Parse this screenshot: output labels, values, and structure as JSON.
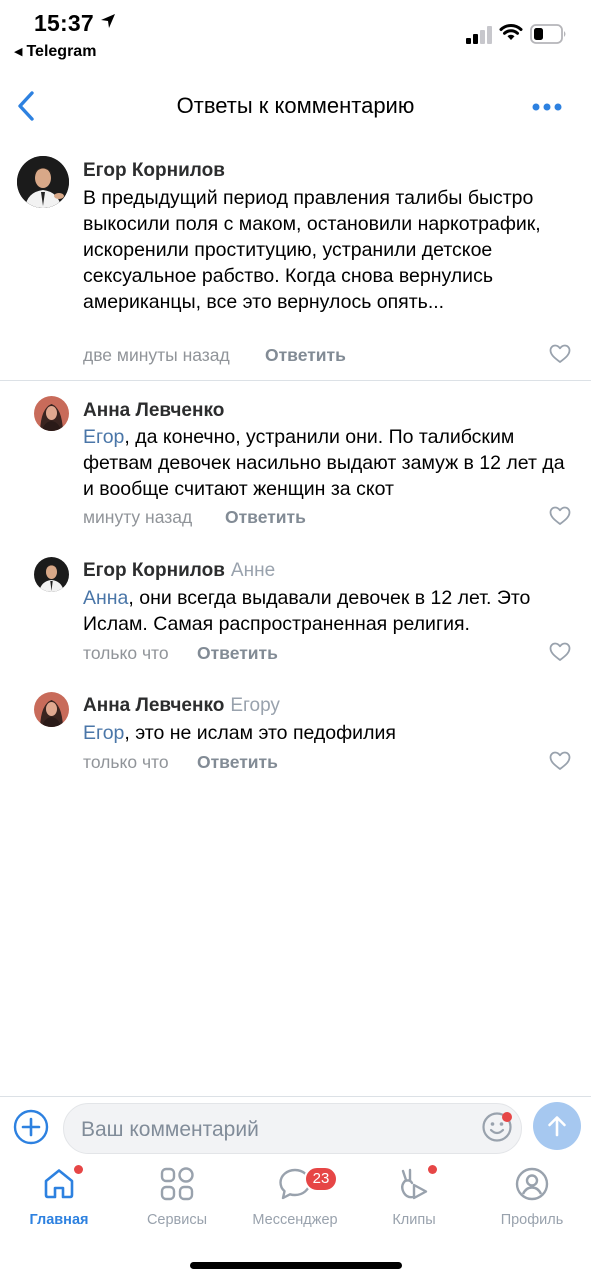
{
  "status_bar": {
    "time": "15:37",
    "back_app": "Telegram"
  },
  "header": {
    "title": "Ответы к комментарию"
  },
  "comments": [
    {
      "author": "Егор Корнилов",
      "reply_to": "",
      "mention": "",
      "text": "В предыдущий период правления талибы быстро выкосили поля с маком, остановили наркотрафик, искоренили проституцию, устранили детское сексуальное рабство.  Когда снова вернулись американцы, все это вернулось опять...",
      "time": "две минуты назад",
      "reply_label": "Ответить"
    },
    {
      "author": "Анна Левченко",
      "reply_to": "",
      "mention": "Егор",
      "text": ", да конечно, устранили они. По талибским фетвам девочек насильно выдают замуж в 12 лет да и вообще считают женщин за скот",
      "time": "минуту назад",
      "reply_label": "Ответить"
    },
    {
      "author": "Егор Корнилов",
      "reply_to": "Анне",
      "mention": "Анна",
      "text": ", они всегда выдавали девочек в 12 лет. Это Ислам. Самая распространенная религия.",
      "time": "только что",
      "reply_label": "Ответить"
    },
    {
      "author": "Анна Левченко",
      "reply_to": "Егору",
      "mention": "Егор",
      "text": ", это не ислам это педофилия",
      "time": "только что",
      "reply_label": "Ответить"
    }
  ],
  "composer": {
    "placeholder": "Ваш комментарий"
  },
  "tabbar": {
    "items": [
      {
        "label": "Главная",
        "icon": "home-icon",
        "active": true,
        "dot": true
      },
      {
        "label": "Сервисы",
        "icon": "services-icon",
        "active": false,
        "dot": false
      },
      {
        "label": "Мессенджер",
        "icon": "messenger-icon",
        "active": false,
        "badge": "23"
      },
      {
        "label": "Клипы",
        "icon": "clips-icon",
        "active": false,
        "dot": true
      },
      {
        "label": "Профиль",
        "icon": "profile-icon",
        "active": false,
        "dot": false
      }
    ]
  },
  "colors": {
    "accent": "#2d81e0",
    "mention": "#4a76a8",
    "badge": "#e64646",
    "muted": "#99a2ad"
  }
}
